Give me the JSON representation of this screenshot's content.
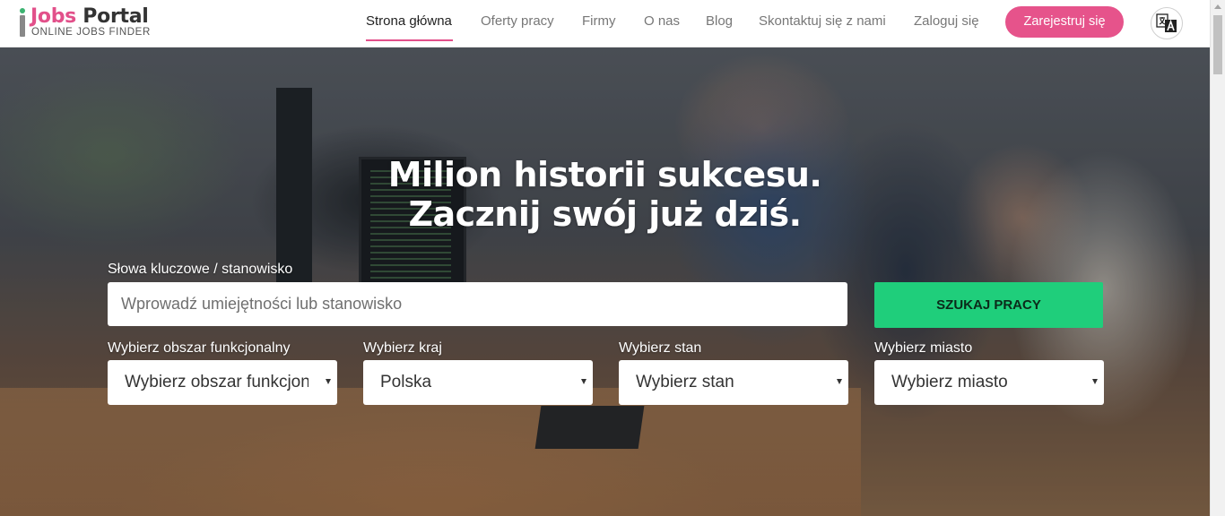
{
  "header": {
    "logo": {
      "title_part1": "i",
      "title_part2": "Jobs",
      "title_part3": " Portal",
      "subtitle": "ONLINE JOBS FINDER"
    },
    "nav": [
      {
        "label": "Strona główna",
        "active": true
      },
      {
        "label": "Oferty pracy",
        "active": false
      },
      {
        "label": "Firmy",
        "active": false
      },
      {
        "label": "O nas",
        "active": false
      },
      {
        "label": "Blog",
        "active": false
      },
      {
        "label": "Skontaktuj się z nami",
        "active": false
      },
      {
        "label": "Zaloguj się",
        "active": false
      }
    ],
    "register_label": "Zarejestruj się",
    "translate_icon": "translate-icon"
  },
  "hero": {
    "title_line1": "Milion historii sukcesu.",
    "title_line2": "Zacznij swój już dziś."
  },
  "search": {
    "keywords_label": "Słowa kluczowe / stanowisko",
    "keywords_placeholder": "Wprowadź umiejętności lub stanowisko",
    "keywords_value": "",
    "submit_label": "SZUKAJ PRACY",
    "filters": [
      {
        "label": "Wybierz obszar funkcjonalny",
        "value": "Wybierz obszar funkcjonalny"
      },
      {
        "label": "Wybierz kraj",
        "value": "Polska"
      },
      {
        "label": "Wybierz stan",
        "value": "Wybierz stan"
      },
      {
        "label": "Wybierz miasto",
        "value": "Wybierz miasto"
      }
    ]
  },
  "colors": {
    "accent": "#e6538b",
    "search_button": "#1fce7b"
  }
}
